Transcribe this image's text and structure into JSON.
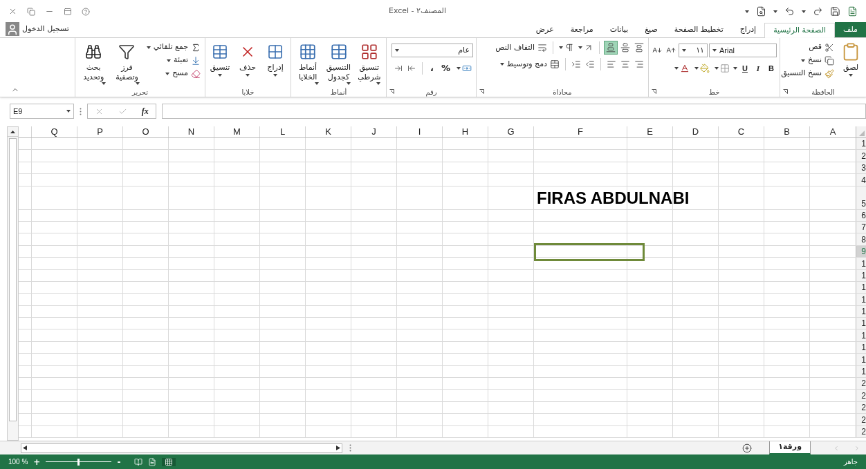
{
  "window": {
    "title": "المصنف٢ - Excel"
  },
  "account": {
    "sign_in": "تسجيل الدخول"
  },
  "tabs": [
    {
      "label": "ملف",
      "kind": "file",
      "selected": false
    },
    {
      "label": "الصفحة الرئيسية",
      "kind": "tab",
      "selected": true
    },
    {
      "label": "إدراج",
      "kind": "tab",
      "selected": false
    },
    {
      "label": "تخطيط الصفحة",
      "kind": "tab",
      "selected": false
    },
    {
      "label": "صيغ",
      "kind": "tab",
      "selected": false
    },
    {
      "label": "بيانات",
      "kind": "tab",
      "selected": false
    },
    {
      "label": "مراجعة",
      "kind": "tab",
      "selected": false
    },
    {
      "label": "عرض",
      "kind": "tab",
      "selected": false
    }
  ],
  "ribbon": {
    "groups": [
      {
        "kind": "clipboard",
        "label": "الحافظة",
        "paste": "لصق",
        "cut": "قص",
        "copy": "نسخ",
        "format_painter": "نسخ التنسيق"
      },
      {
        "kind": "font",
        "label": "خط",
        "font_name": "Arial",
        "font_size": "١١",
        "bold": "B",
        "italic": "I",
        "underline": "U"
      },
      {
        "kind": "alignment",
        "label": "محاذاة",
        "wrap_text": "التفاف النص",
        "merge_center": "دمج وتوسيط",
        "vertical_align": [
          {
            "selected": false
          },
          {
            "selected": false
          },
          {
            "selected": true
          }
        ]
      },
      {
        "kind": "number",
        "label": "رقم",
        "format": "عام",
        "percent": "%",
        "comma": "،"
      },
      {
        "kind": "styles",
        "label": "أنماط",
        "buttons": [
          "تنسيق شرطي",
          "التنسيق كجدول",
          "أنماط الخلايا"
        ]
      },
      {
        "kind": "cells",
        "label": "خلايا",
        "buttons": [
          "إدراج",
          "حذف",
          "تنسيق"
        ]
      },
      {
        "kind": "editing",
        "label": "تحرير",
        "autosum": "جمع تلقائي",
        "fill": "تعبئة",
        "clear": "مسح",
        "sort_filter": "فرز وتصفية",
        "find_select": "بحث وتحديد"
      }
    ]
  },
  "formula_bar": {
    "name_box": "E9",
    "function_label": "fx"
  },
  "sheet": {
    "columns": [
      "A",
      "B",
      "C",
      "D",
      "E",
      "F",
      "G",
      "H",
      "I",
      "J",
      "K",
      "L",
      "M",
      "N",
      "O",
      "P",
      "Q"
    ],
    "rows": [
      {
        "header": "1",
        "selected": false
      },
      {
        "header": "2",
        "selected": false
      },
      {
        "header": "3",
        "selected": false
      },
      {
        "header": "4",
        "selected": false
      },
      {
        "header": "5",
        "selected": false,
        "text": "FIRAS ABDULNABI"
      },
      {
        "header": "6",
        "selected": false
      },
      {
        "header": "7",
        "selected": false
      },
      {
        "header": "8",
        "selected": false
      },
      {
        "header": "9",
        "selected": true
      },
      {
        "header": "1",
        "selected": false
      },
      {
        "header": "1",
        "selected": false
      },
      {
        "header": "1",
        "selected": false
      },
      {
        "header": "1",
        "selected": false
      },
      {
        "header": "1",
        "selected": false
      },
      {
        "header": "1",
        "selected": false
      },
      {
        "header": "1",
        "selected": false
      },
      {
        "header": "1",
        "selected": false
      },
      {
        "header": "1",
        "selected": false
      },
      {
        "header": "1",
        "selected": false
      },
      {
        "header": "2",
        "selected": false
      },
      {
        "header": "2",
        "selected": false
      },
      {
        "header": "2",
        "selected": false
      },
      {
        "header": "2",
        "selected": false
      },
      {
        "header": "2",
        "selected": false
      }
    ]
  },
  "sheet_tabs": [
    {
      "label": "ورقة١",
      "selected": true
    }
  ],
  "status_bar": {
    "status": "جاهز",
    "zoom": "100 %",
    "zoom_in": "+",
    "zoom_out": "-",
    "zoom_slider": {
      "level": 0.5
    }
  }
}
